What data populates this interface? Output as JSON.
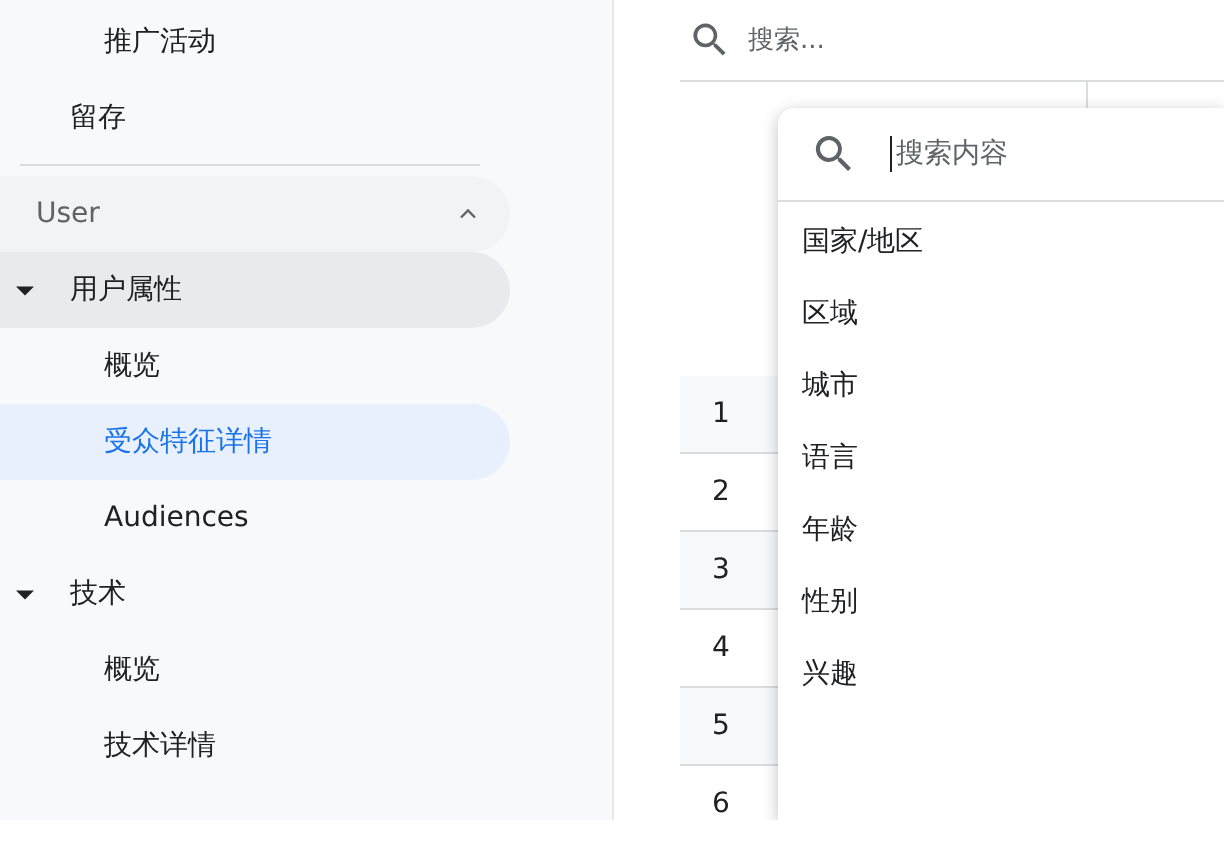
{
  "sidebar": {
    "items": [
      {
        "label": "推广活动",
        "kind": "subitem"
      },
      {
        "label": "留存",
        "kind": "item"
      }
    ],
    "section": {
      "title": "User",
      "expanded": true,
      "groups": [
        {
          "label": "用户属性",
          "expanded": true,
          "highlighted": true,
          "children": [
            {
              "label": "概览",
              "selected": false
            },
            {
              "label": "受众特征详情",
              "selected": true
            },
            {
              "label": "Audiences",
              "selected": false
            }
          ]
        },
        {
          "label": "技术",
          "expanded": true,
          "highlighted": false,
          "children": [
            {
              "label": "概览",
              "selected": false
            },
            {
              "label": "技术详情",
              "selected": false
            }
          ]
        }
      ]
    }
  },
  "main": {
    "search": {
      "placeholder": "搜索..."
    },
    "table": {
      "rows": [
        {
          "number": "1"
        },
        {
          "number": "2"
        },
        {
          "number": "3"
        },
        {
          "number": "4"
        },
        {
          "number": "5"
        },
        {
          "number": "6"
        }
      ]
    }
  },
  "dropdown": {
    "search": {
      "placeholder": "搜索内容",
      "focused": true
    },
    "options": [
      "国家/地区",
      "区域",
      "城市",
      "语言",
      "年龄",
      "性别",
      "兴趣"
    ]
  }
}
